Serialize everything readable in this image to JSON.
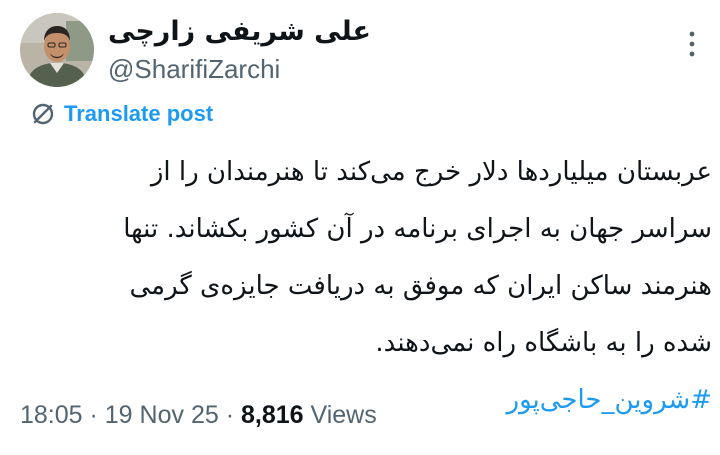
{
  "author": {
    "display_name": "علی شریفی زارچی",
    "handle": "@SharifiZarchi"
  },
  "translate": {
    "label": "Translate post",
    "icon": "translate-off-icon"
  },
  "tweet": {
    "lines": [
      "عربستان میلیاردها دلار خرج می‌کند تا هنرمندان را از",
      "سراسر جهان به اجرای برنامه در آن کشور بکشاند. تنها",
      "هنرمند ساکن ایران که موفق به دریافت جایزه‌ی گرمی",
      "شده را به باشگاه راه نمی‌دهند."
    ],
    "hashtag": "#شروین_حاجی‌پور"
  },
  "meta": {
    "time": "18:05",
    "separator": " · ",
    "date": "19 Nov 25",
    "views_count": "8,816",
    "views_label": " Views"
  },
  "colors": {
    "accent": "#1d9bf0",
    "text": "#0f1419",
    "muted": "#536471"
  }
}
